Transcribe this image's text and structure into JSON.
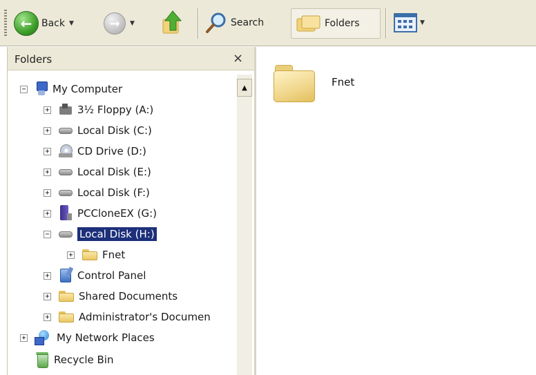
{
  "toolbar": {
    "back_label": "Back",
    "search_label": "Search",
    "folders_label": "Folders"
  },
  "icons": {
    "back": "back-arrow-icon",
    "forward": "forward-arrow-icon",
    "up": "up-folder-icon",
    "search": "search-icon",
    "folders": "folders-icon",
    "views": "views-icon"
  },
  "folders_pane": {
    "title": "Folders",
    "close_glyph": "×",
    "tree": [
      {
        "label": "My Computer",
        "icon": "computer-icon",
        "expander": "−"
      },
      {
        "label": "3½ Floppy (A:)",
        "icon": "floppy-icon",
        "expander": "+"
      },
      {
        "label": "Local Disk (C:)",
        "icon": "disk-icon",
        "expander": "+"
      },
      {
        "label": "CD Drive (D:)",
        "icon": "cd-icon",
        "expander": "+"
      },
      {
        "label": "Local Disk (E:)",
        "icon": "disk-icon",
        "expander": "+"
      },
      {
        "label": "Local Disk (F:)",
        "icon": "disk-icon",
        "expander": "+"
      },
      {
        "label": "PCCloneEX (G:)",
        "icon": "usb-drive-icon",
        "expander": "+"
      },
      {
        "label": "Local Disk (H:)",
        "icon": "disk-icon",
        "expander": "−",
        "selected": true
      },
      {
        "label": "Fnet",
        "icon": "folder-icon",
        "expander": "+"
      },
      {
        "label": "Control Panel",
        "icon": "control-panel-icon",
        "expander": "+"
      },
      {
        "label": "Shared Documents",
        "icon": "folder-icon",
        "expander": "+"
      },
      {
        "label": "Administrator's Documen",
        "icon": "folder-icon",
        "expander": "+"
      },
      {
        "label": "My Network Places",
        "icon": "network-icon",
        "expander": "+"
      },
      {
        "label": "Recycle Bin",
        "icon": "recycle-bin-icon",
        "expander": ""
      }
    ]
  },
  "content": {
    "items": [
      {
        "label": "Fnet",
        "icon": "folder-icon"
      }
    ]
  },
  "colors": {
    "toolbar_bg": "#ece9d8",
    "selection_bg": "#1c2f7a",
    "selection_text": "#ffffff"
  }
}
